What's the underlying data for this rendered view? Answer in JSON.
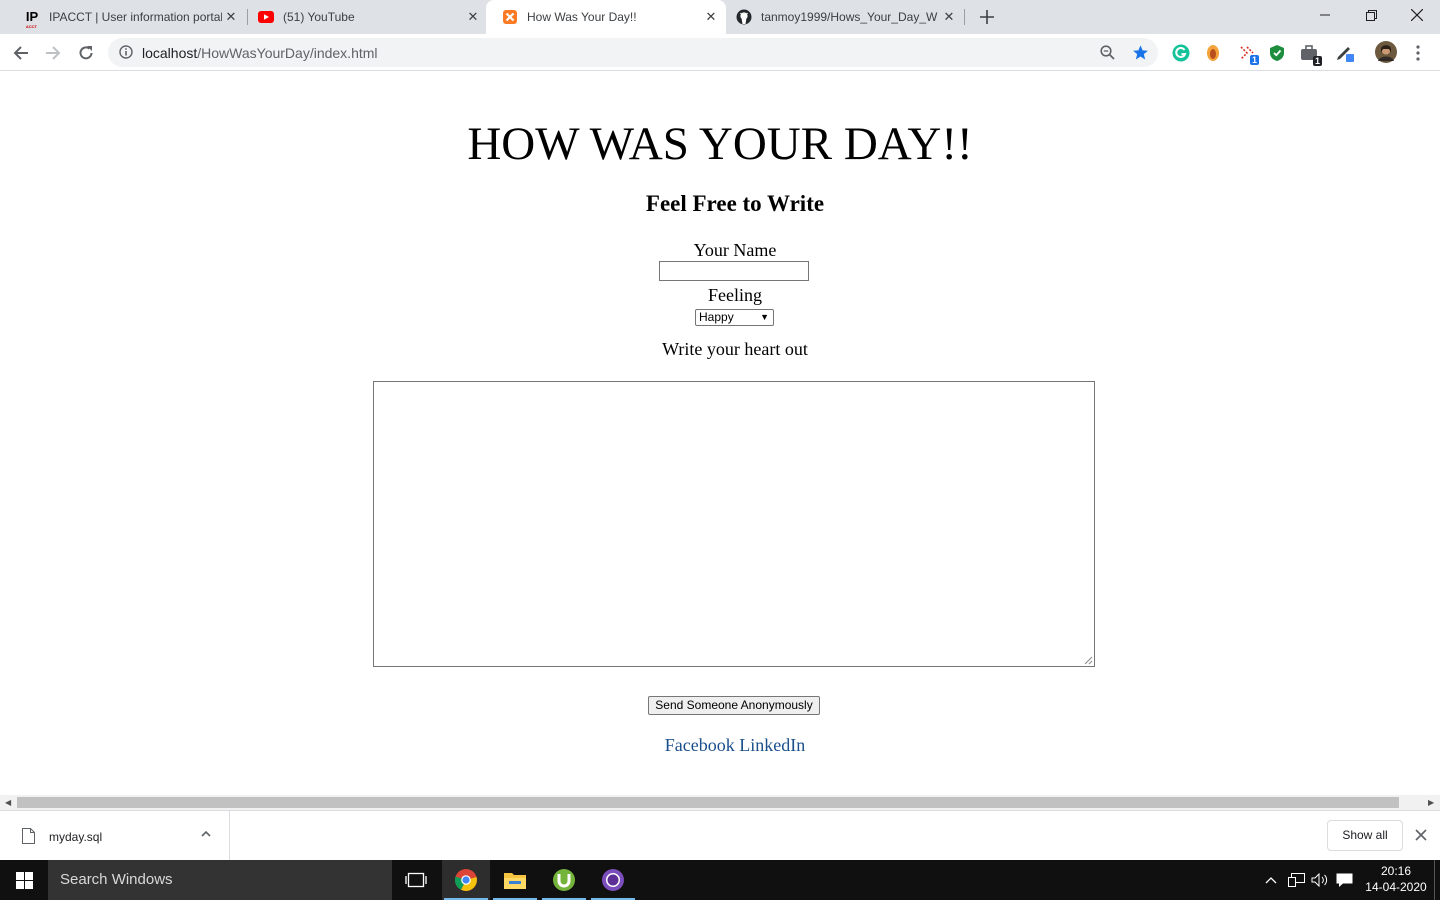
{
  "browser": {
    "tabs": [
      {
        "title": "IPACCT | User information portal",
        "icon": "ipacct-favicon"
      },
      {
        "title": "(51) YouTube",
        "icon": "youtube-favicon"
      },
      {
        "title": "How Was Your Day!!",
        "icon": "xampp-favicon"
      },
      {
        "title": "tanmoy1999/Hows_Your_Day_W",
        "icon": "github-favicon"
      }
    ],
    "ipacct_logo": "IP",
    "ipacct_logo_sub": "ACCT",
    "url_host": "localhost",
    "url_path": "/HowWasYourDay/index.html",
    "extension_badges": {
      "ext_a": "1",
      "ext_b": "1"
    }
  },
  "page": {
    "heading": "HOW WAS YOUR DAY!!",
    "subheading": "Feel Free to Write",
    "name_label": "Your Name",
    "name_value": "",
    "feeling_label": "Feeling",
    "feeling_selected": "Happy",
    "textarea_label": "Write your heart out",
    "textarea_value": "",
    "send_button": "Send Someone Anonymously",
    "link_facebook": "Facebook",
    "link_linkedin": "LinkedIn",
    "link_color": "#1a4f8b"
  },
  "downloads": {
    "file_name": "myday.sql",
    "show_all": "Show all"
  },
  "taskbar": {
    "search_placeholder": "Search Windows",
    "time": "20:16",
    "date": "14-04-2020"
  }
}
